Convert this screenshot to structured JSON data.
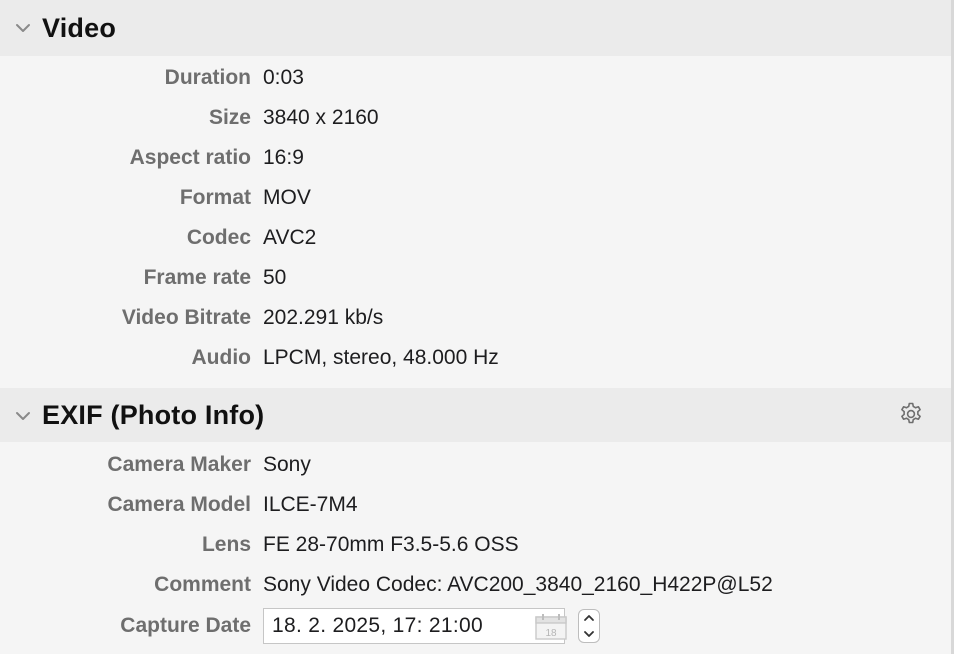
{
  "video": {
    "title": "Video",
    "rows": [
      {
        "label": "Duration",
        "value": "0:03"
      },
      {
        "label": "Size",
        "value": "3840 x 2160"
      },
      {
        "label": "Aspect ratio",
        "value": "16:9"
      },
      {
        "label": "Format",
        "value": "MOV"
      },
      {
        "label": "Codec",
        "value": "AVC2"
      },
      {
        "label": "Frame rate",
        "value": "50"
      },
      {
        "label": "Video Bitrate",
        "value": "202.291 kb/s"
      },
      {
        "label": "Audio",
        "value": "LPCM, stereo, 48.000 Hz"
      }
    ]
  },
  "exif": {
    "title": "EXIF (Photo Info)",
    "rows": [
      {
        "label": "Camera Maker",
        "value": "Sony"
      },
      {
        "label": "Camera Model",
        "value": "ILCE-7M4"
      },
      {
        "label": "Lens",
        "value": "FE 28-70mm F3.5-5.6 OSS"
      },
      {
        "label": "Comment",
        "value": "Sony Video Codec: AVC200_3840_2160_H422P@L52"
      }
    ],
    "capture_date": {
      "label": "Capture Date",
      "value": "18.  2. 2025,  17: 21:00",
      "calendar_day": "18"
    }
  },
  "icons": {
    "video_chevron": "chevron-down-icon",
    "exif_chevron": "chevron-down-icon",
    "settings": "gear-icon",
    "calendar": "calendar-icon",
    "stepper": "stepper-icon"
  }
}
